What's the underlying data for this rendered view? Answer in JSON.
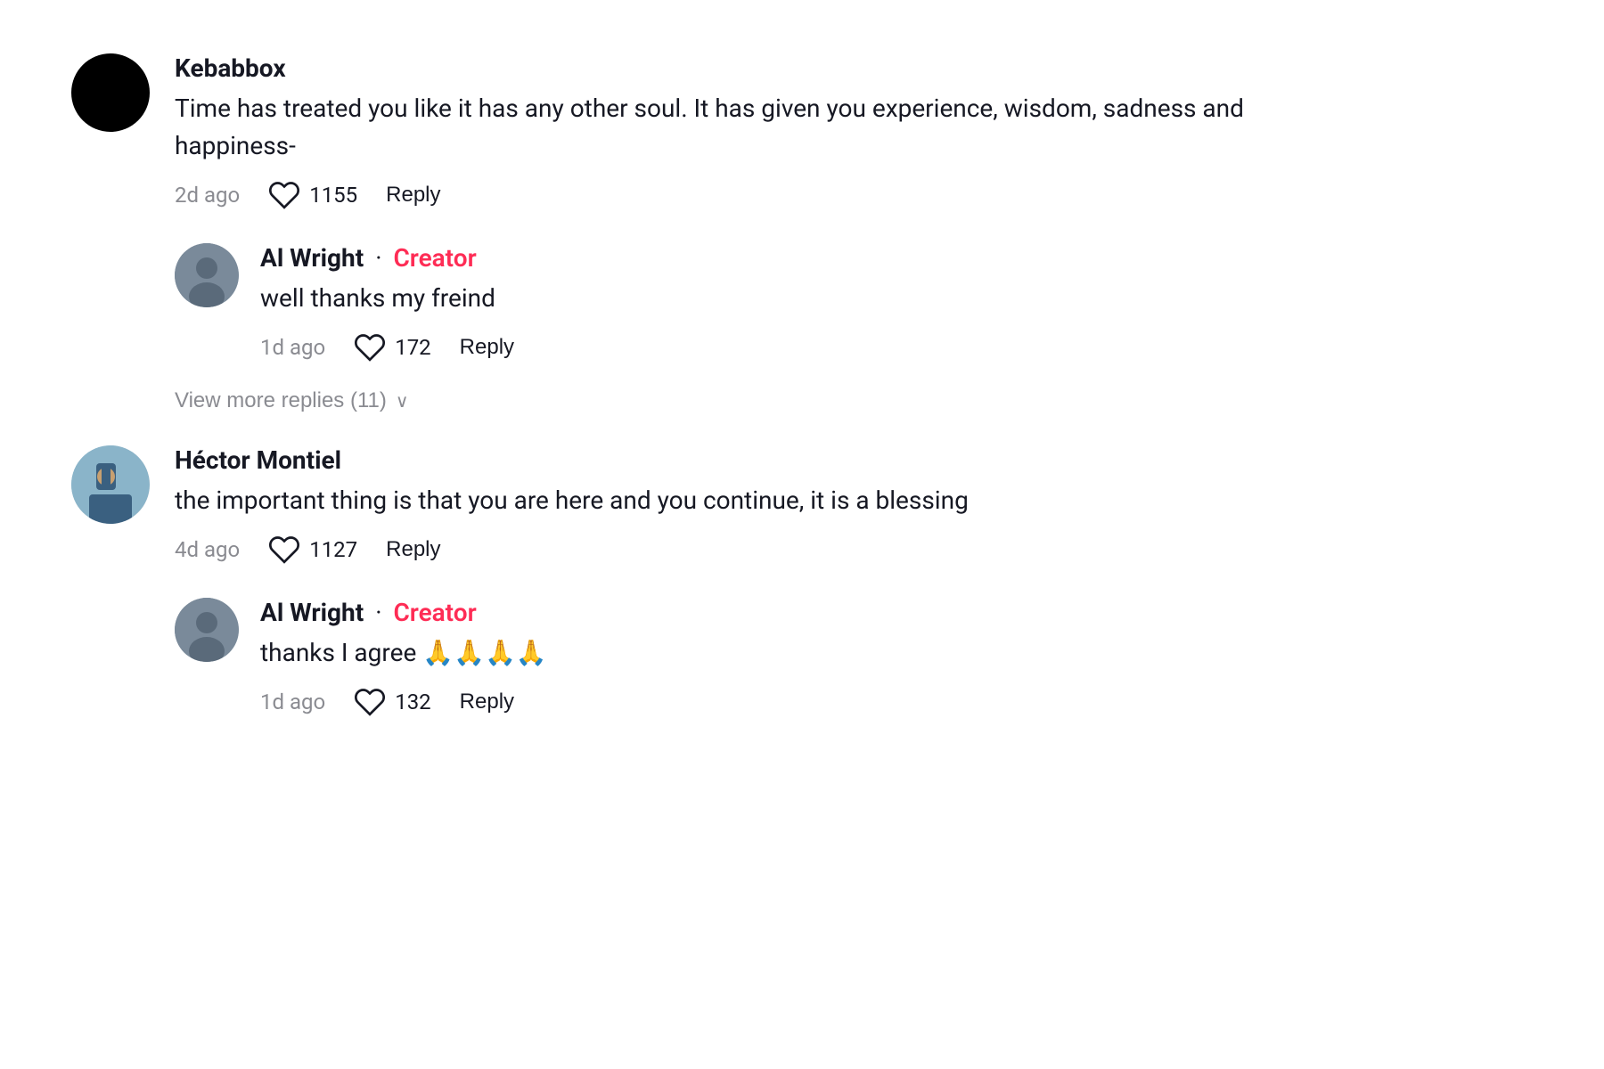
{
  "comments": [
    {
      "id": "comment-1",
      "username": "Kebabbox",
      "avatar_type": "black",
      "text": "Time has treated you like it has any other soul. It has given you experience, wisdom, sadness and happiness-",
      "time": "2d ago",
      "likes": "1155",
      "is_creator": false,
      "replies": [
        {
          "id": "reply-1-1",
          "username": "Al Wright",
          "is_creator": true,
          "creator_label": "Creator",
          "avatar_type": "alwright",
          "text": "well thanks my freind",
          "time": "1d ago",
          "likes": "172"
        }
      ],
      "view_more_text": "View more replies (11)"
    },
    {
      "id": "comment-2",
      "username": "Héctor Montiel",
      "avatar_type": "hector",
      "text": "the important thing is that you are here and you continue, it is a blessing",
      "time": "4d ago",
      "likes": "1127",
      "is_creator": false,
      "replies": [
        {
          "id": "reply-2-1",
          "username": "Al Wright",
          "is_creator": true,
          "creator_label": "Creator",
          "avatar_type": "alwright",
          "text": "thanks I agree 🙏🙏🙏🙏",
          "time": "1d ago",
          "likes": "132"
        }
      ],
      "view_more_text": null
    }
  ],
  "labels": {
    "reply": "Reply",
    "dot": "·",
    "chevron_down": "∨"
  }
}
